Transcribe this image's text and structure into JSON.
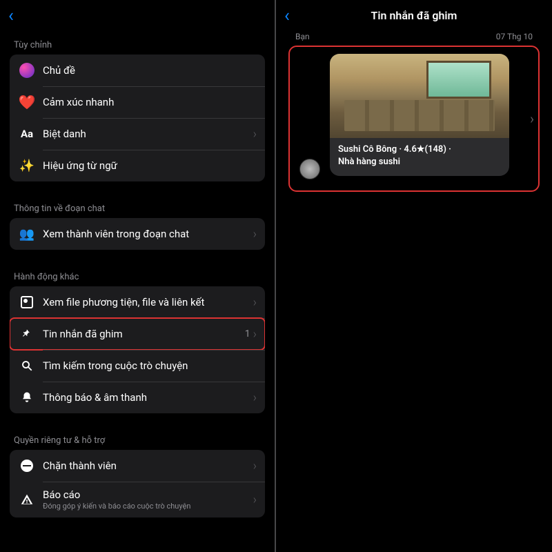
{
  "left": {
    "section_customize": "Tùy chỉnh",
    "items_customize": [
      {
        "label": "Chủ đề",
        "icon": "theme",
        "chev": false
      },
      {
        "label": "Cảm xúc nhanh",
        "icon": "heart",
        "chev": false
      },
      {
        "label": "Biệt danh",
        "icon": "aa",
        "chev": true
      },
      {
        "label": "Hiệu ứng từ ngữ",
        "icon": "wand",
        "chev": false
      }
    ],
    "section_info": "Thông tin về đoạn chat",
    "items_info": [
      {
        "label": "Xem thành viên trong đoạn chat",
        "icon": "members",
        "chev": true
      }
    ],
    "section_actions": "Hành động khác",
    "items_actions": [
      {
        "label": "Xem file phương tiện, file và liên kết",
        "icon": "media",
        "chev": true
      },
      {
        "label": "Tin nhắn đã ghim",
        "icon": "pin",
        "chev": true,
        "badge": "1",
        "hl": true
      },
      {
        "label": "Tìm kiếm trong cuộc trò chuyện",
        "icon": "search",
        "chev": false
      },
      {
        "label": "Thông báo & âm thanh",
        "icon": "bell",
        "chev": true
      }
    ],
    "section_privacy": "Quyền riêng tư & hỗ trợ",
    "items_privacy": [
      {
        "label": "Chặn thành viên",
        "icon": "block",
        "chev": true
      },
      {
        "label": "Báo cáo",
        "sub": "Đóng góp ý kiến và báo cáo cuộc trò chuyện",
        "icon": "warn",
        "chev": true
      }
    ]
  },
  "right": {
    "title": "Tin nhắn đã ghim",
    "sender": "Bạn",
    "date": "07 Thg 10",
    "card_line1": "Sushi Cô Bông · 4.6★(148) ·",
    "card_line2": "Nhà hàng sushi"
  }
}
